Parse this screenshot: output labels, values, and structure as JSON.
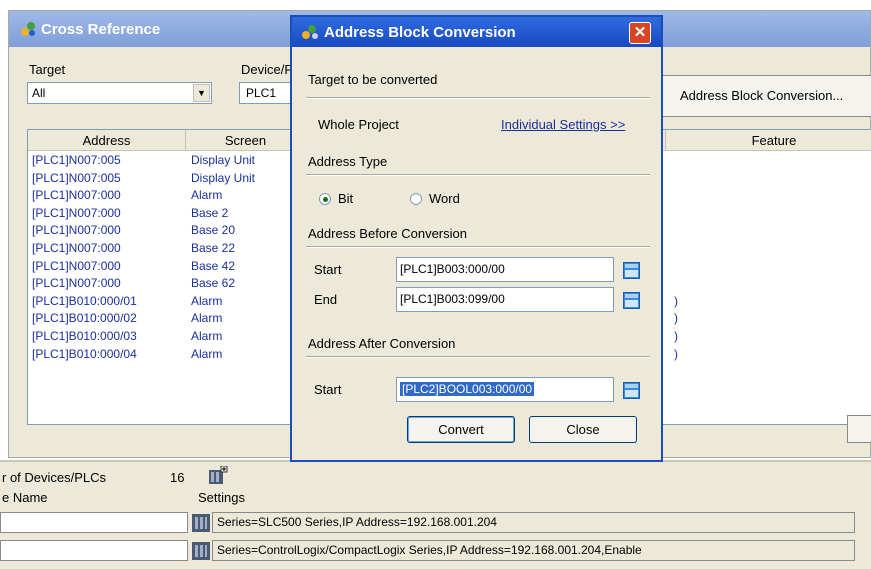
{
  "xref": {
    "title": "Cross Reference",
    "target_label": "Target",
    "target_value": "All",
    "device_label": "Device/F",
    "device_value": "PLC1",
    "abc_button": "Address Block Conversion...",
    "columns": {
      "address": "Address",
      "screen": "Screen",
      "feature": "Feature"
    },
    "rows": [
      {
        "address": "[PLC1]N007:005",
        "screen": "Display Unit"
      },
      {
        "address": "[PLC1]N007:005",
        "screen": "Display Unit"
      },
      {
        "address": "[PLC1]N007:000",
        "screen": "Alarm"
      },
      {
        "address": "[PLC1]N007:000",
        "screen": "Base 2"
      },
      {
        "address": "[PLC1]N007:000",
        "screen": "Base 20"
      },
      {
        "address": "[PLC1]N007:000",
        "screen": "Base 22"
      },
      {
        "address": "[PLC1]N007:000",
        "screen": "Base 42"
      },
      {
        "address": "[PLC1]N007:000",
        "screen": "Base 62"
      },
      {
        "address": "[PLC1]B010:000/01",
        "screen": "Alarm"
      },
      {
        "address": "[PLC1]B010:000/02",
        "screen": "Alarm"
      },
      {
        "address": "[PLC1]B010:000/03",
        "screen": "Alarm"
      },
      {
        "address": "[PLC1]B010:000/04",
        "screen": "Alarm"
      }
    ],
    "feature_fragment": ")"
  },
  "bottom": {
    "devices_label": "r of Devices/PLCs",
    "devices_count": "16",
    "name_label": "e Name",
    "settings_label": "Settings",
    "rows": [
      "Series=SLC500 Series,IP Address=192.168.001.204",
      "Series=ControlLogix/CompactLogix Series,IP Address=192.168.001.204,Enable"
    ]
  },
  "dialog": {
    "title": "Address Block Conversion",
    "close_glyph": "✕",
    "target_section": "Target to be converted",
    "whole_project": "Whole Project",
    "individual_settings": "Individual Settings >>",
    "address_type_section": "Address Type",
    "bit_label": "Bit",
    "word_label": "Word",
    "selected_type": "Bit",
    "before_section": "Address Before Conversion",
    "start_label": "Start",
    "end_label": "End",
    "before_start": "[PLC1]B003:000/00",
    "before_end": "[PLC1]B003:099/00",
    "after_section": "Address After Conversion",
    "after_start_label": "Start",
    "after_start": "[PLC2]BOOL003:000/00",
    "convert_button": "Convert",
    "close_button": "Close"
  },
  "colors": {
    "dialog_title_bar": "#1849c2",
    "link": "#1a2f9c",
    "selection": "#316ac5",
    "window_face": "#ece9d8"
  }
}
